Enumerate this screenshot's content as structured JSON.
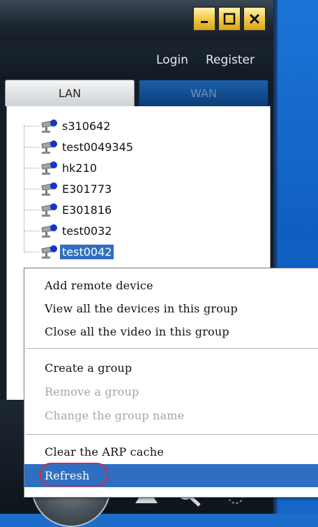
{
  "window": {
    "controls": [
      {
        "name": "minimize-icon",
        "label": "_"
      },
      {
        "name": "maximize-icon",
        "label": "□"
      },
      {
        "name": "close-icon",
        "label": "×"
      }
    ]
  },
  "auth": {
    "login": "Login",
    "register": "Register"
  },
  "tabs": [
    {
      "label": "LAN",
      "active": true
    },
    {
      "label": "WAN",
      "active": false
    }
  ],
  "devices": [
    {
      "label": "s310642"
    },
    {
      "label": "test0049345"
    },
    {
      "label": "hk210"
    },
    {
      "label": "E301773"
    },
    {
      "label": "E301816"
    },
    {
      "label": "test0032"
    },
    {
      "label": "test0042",
      "selected": true
    }
  ],
  "context_menu": {
    "items": [
      {
        "label": "Add remote device",
        "enabled": true
      },
      {
        "label": "View all the devices in this group",
        "enabled": true
      },
      {
        "label": "Close all the video in this group",
        "enabled": true
      },
      {
        "label": "Create a group",
        "enabled": true
      },
      {
        "label": "Remove a group",
        "enabled": false
      },
      {
        "label": "Change the group name",
        "enabled": false
      },
      {
        "label": "Clear the ARP cache",
        "enabled": true
      },
      {
        "label": "Refresh",
        "enabled": true,
        "highlighted": true
      }
    ]
  },
  "colors": {
    "selection": "#2f6fc2",
    "annotation_ring": "#e0253d",
    "desktop": "#1c6cc9"
  }
}
